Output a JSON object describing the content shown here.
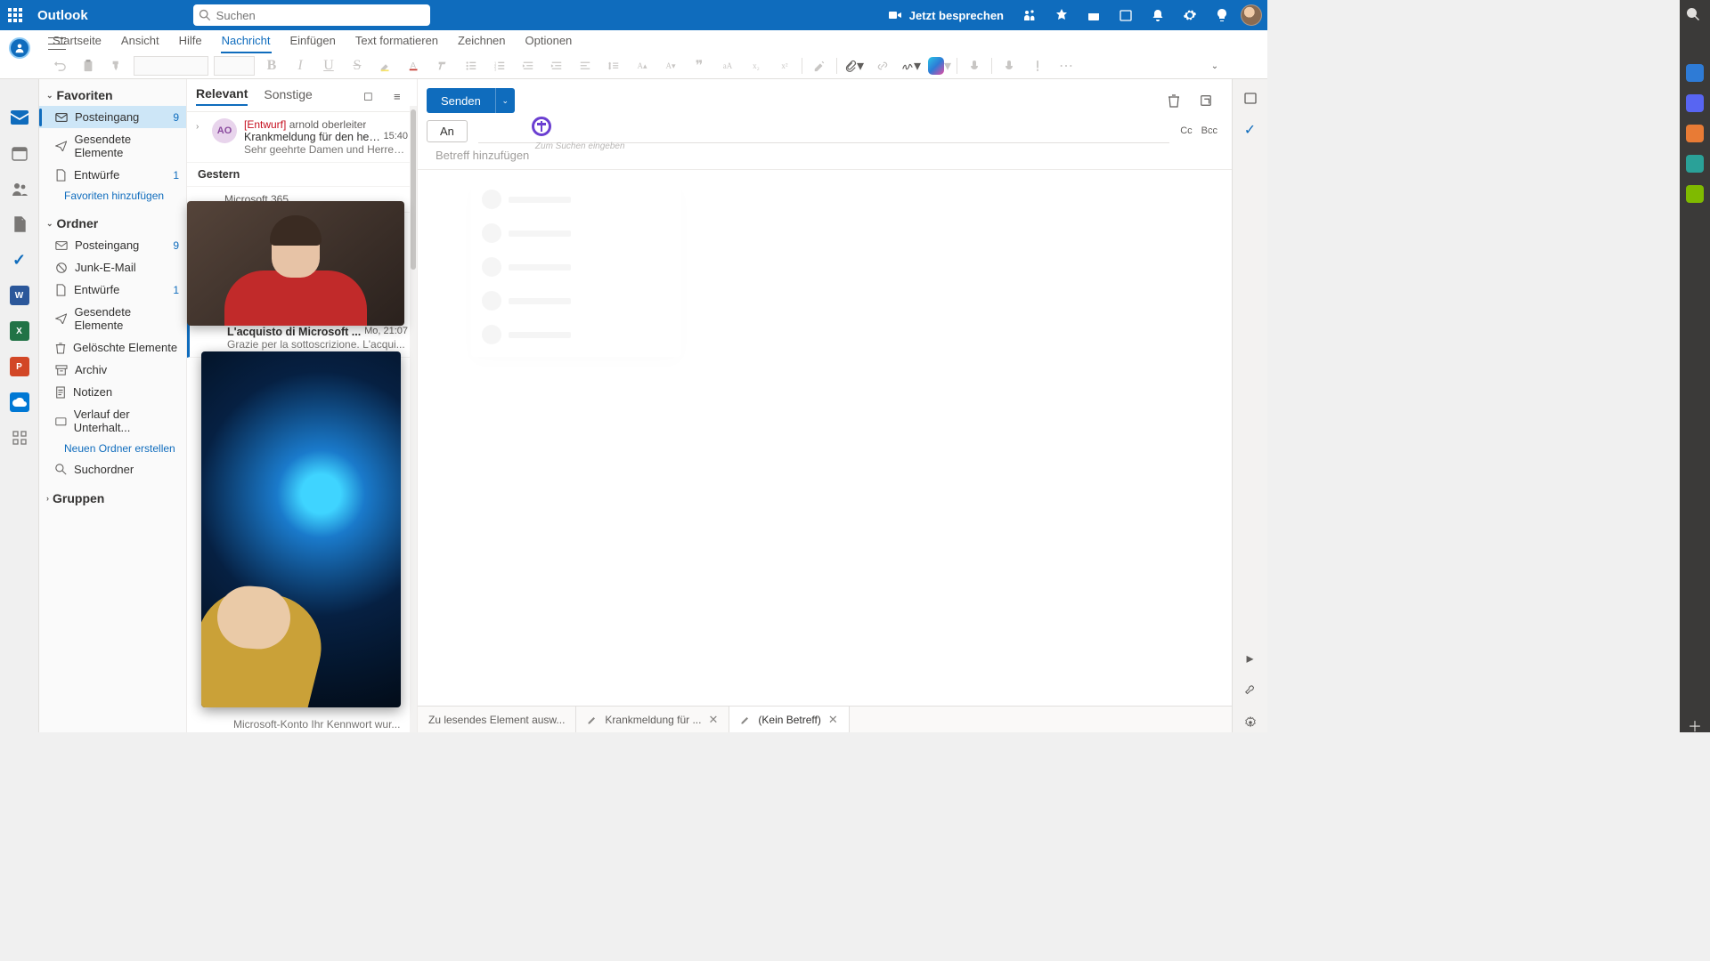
{
  "header": {
    "app_name": "Outlook",
    "search_placeholder": "Suchen",
    "meet_now": "Jetzt besprechen"
  },
  "ribbon": {
    "tabs": {
      "home": "Startseite",
      "view": "Ansicht",
      "help": "Hilfe",
      "message": "Nachricht",
      "insert": "Einfügen",
      "format": "Text formatieren",
      "draw": "Zeichnen",
      "options": "Optionen"
    }
  },
  "folders": {
    "fav_header": "Favoriten",
    "inbox": "Posteingang",
    "inbox_count": "9",
    "sent": "Gesendete Elemente",
    "drafts": "Entwürfe",
    "drafts_count": "1",
    "add_fav": "Favoriten hinzufügen",
    "folders_header": "Ordner",
    "inbox2": "Posteingang",
    "inbox2_count": "9",
    "junk": "Junk-E-Mail",
    "drafts2": "Entwürfe",
    "drafts2_count": "1",
    "sent2": "Gesendete Elemente",
    "deleted": "Gelöschte Elemente",
    "archive": "Archiv",
    "notes": "Notizen",
    "conv": "Verlauf der Unterhalt...",
    "new_folder": "Neuen Ordner erstellen",
    "search_folder": "Suchordner",
    "groups": "Gruppen"
  },
  "msglist": {
    "tab_focused": "Relevant",
    "tab_other": "Sonstige",
    "m1_avatar": "AO",
    "m1_draft": "[Entwurf]",
    "m1_from": "arnold oberleiter",
    "m1_subject": "Krankmeldung für den heut...",
    "m1_time": "15:40",
    "m1_preview": "Sehr geehrte Damen und Herren, i...",
    "date1": "Gestern",
    "m2_from": "Microsoft 365",
    "m3_subject": "L'acquisto di Microsoft ...",
    "m3_time": "Mo, 21:07",
    "m3_preview": "Grazie per la sottoscrizione. L'acqui...",
    "below": "Microsoft-Konto Ihr Kennwort wur..."
  },
  "compose": {
    "send": "Senden",
    "to_btn": "An",
    "to_hint": "Zum Suchen eingeben",
    "cc": "Cc",
    "bcc": "Bcc",
    "subject_ph": "Betreff hinzufügen"
  },
  "bottom": {
    "t1": "Zu lesendes Element ausw...",
    "t2": "Krankmeldung für ...",
    "t3": "(Kein Betreff)"
  }
}
